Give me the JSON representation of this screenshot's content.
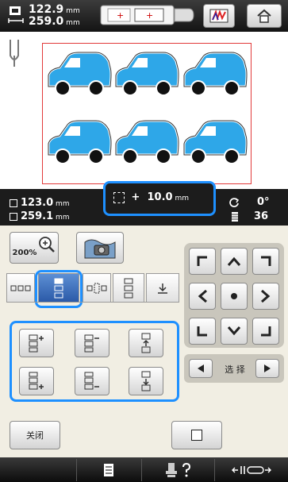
{
  "topbar": {
    "height_value": "122.9",
    "width_value": "259.0",
    "unit": "mm"
  },
  "info": {
    "height_value": "123.0",
    "width_value": "259.1",
    "unit": "mm",
    "offset_sign": "+",
    "offset_value": "10.0",
    "offset_unit": "mm",
    "rotation_value": "0°",
    "thread_count": "36"
  },
  "panel": {
    "zoom_label": "200%",
    "select_label": "选 择",
    "close_label": "关闭"
  },
  "icons": [
    "dimension-icon",
    "frame-icon",
    "color-palette-icon",
    "home-icon",
    "needle-icon",
    "zoom-icon",
    "background-icon",
    "layout-icon",
    "arrow-up-icon",
    "arrow-down-icon",
    "arrow-left-icon",
    "arrow-right-icon",
    "rotate-icon",
    "thread-icon",
    "checklist-icon",
    "help-icon",
    "foot-icon"
  ],
  "colors": {
    "accent": "#1e90ff",
    "design_frame": "#e23a3a",
    "car_body": "#2ea7e8",
    "panel_bg": "#f1eee3"
  }
}
